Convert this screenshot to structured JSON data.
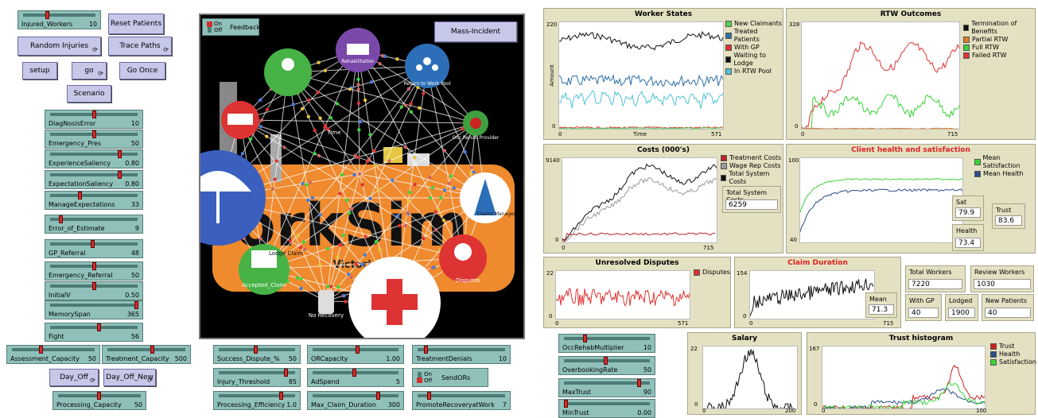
{
  "buttons": {
    "injured_workers": "Injured_Workers",
    "injured_workers_val": "10",
    "reset": "Reset Patients",
    "random": "Random Injuries",
    "trace": "Trace Paths",
    "setup": "setup",
    "go": "go",
    "go_once": "Go Once",
    "scenario": "Scenario",
    "day_off": "Day_Off",
    "day_off_new": "Day_Off_New",
    "mass": "Mass-Incident"
  },
  "sliders": [
    {
      "name": "DiagNosisError",
      "value": "10",
      "level": 0.5
    },
    {
      "name": "Emergency_Pres",
      "value": "50",
      "level": 0.5
    },
    {
      "name": "ExperienceSaliency",
      "value": "0.80",
      "level": 0.8
    },
    {
      "name": "ExpectationSaliency",
      "value": "0.80",
      "level": 0.8
    },
    {
      "name": "ManageExpectations",
      "value": "33",
      "level": 0.33
    },
    {
      "name": "Error_of_Estimate",
      "value": "9",
      "level": 0.1
    },
    {
      "name": "GP_Referral",
      "value": "48",
      "level": 0.48
    },
    {
      "name": "Emergency_Referral",
      "value": "50",
      "level": 0.5
    },
    {
      "name": "InitialV",
      "value": "0.50",
      "level": 0.5
    },
    {
      "name": "MemorySpan",
      "value": "365",
      "level": 1.0
    },
    {
      "name": "Fight",
      "value": "56",
      "level": 0.56
    }
  ],
  "bottom_sliders": {
    "assessment": {
      "name": "Assessment_Capacity",
      "value": "50"
    },
    "treatment": {
      "name": "Treatment_Capacity",
      "value": "500"
    },
    "processing_cap": {
      "name": "Processing_Capacity",
      "value": "50"
    },
    "success": {
      "name": "Success_Dispute_%",
      "value": "50"
    },
    "injury": {
      "name": "Injury_Threshold",
      "value": "85"
    },
    "proc_eff": {
      "name": "Processing_Efficiency",
      "value": "1.0"
    },
    "orcap": {
      "name": "ORCapacity",
      "value": "1.00"
    },
    "adspend": {
      "name": "AdSpend",
      "value": "5"
    },
    "maxclaim": {
      "name": "Max_Claim_Duration",
      "value": "300"
    },
    "denials": {
      "name": "TreatmentDenials",
      "value": "10"
    },
    "promote": {
      "name": "PromoteRecoveryatWork",
      "value": "7"
    },
    "occrehab": {
      "name": "OccRehabMultiplier",
      "value": "10"
    },
    "overbook": {
      "name": "OverbookingRate",
      "value": "50"
    },
    "maxtrust": {
      "name": "MaxTrust",
      "value": "90"
    },
    "mintrust": {
      "name": "MinTrust",
      "value": "0.00"
    }
  },
  "switches": {
    "feedback": "Feedback",
    "sendors": "SendORs",
    "on": "On",
    "off": "Off"
  },
  "world": {
    "banner": "orkSim",
    "subtitle": "Victoria",
    "labels": [
      "Rehabilitation",
      "Return to Work Pool",
      "Occ Rehab Provider",
      "Claims Manager",
      "Disputes",
      "No Recovery",
      "Lodge Claim",
      "Accepted_Claim",
      "Time",
      "Employer"
    ]
  },
  "plots": {
    "worker_states": {
      "title": "Worker States",
      "ymax": "220",
      "ymin": "0",
      "xmin": "0",
      "xmax": "571",
      "xlabel": "Time",
      "ylabel": "Amount",
      "legend": [
        {
          "name": "New Claimants",
          "color": "#55d055"
        },
        {
          "name": "Treated Patients",
          "color": "#2c6fa6"
        },
        {
          "name": "With GP",
          "color": "#d33"
        },
        {
          "name": "Waiting to Lodge",
          "color": "#111"
        },
        {
          "name": "In RTW Pool",
          "color": "#4ec3d6"
        }
      ]
    },
    "rtw": {
      "title": "RTW Outcomes",
      "ymax": "328",
      "ymin": "0",
      "xmin": "0",
      "xmax": "715",
      "legend": [
        {
          "name": "Termination of Benefits",
          "color": "#111"
        },
        {
          "name": "Partial RTW",
          "color": "#e07b22"
        },
        {
          "name": "Full RTW",
          "color": "#3cd33c"
        },
        {
          "name": "Failed RTW",
          "color": "#d33"
        }
      ]
    },
    "costs": {
      "title": "Costs (000's)",
      "ymax": "9140",
      "ymin": "0",
      "xmin": "0",
      "xmax": "715",
      "legend": [
        {
          "name": "Treatment Costs",
          "color": "#b22"
        },
        {
          "name": "Wage Rep Costs",
          "color": "#999"
        },
        {
          "name": "Total System Costs",
          "color": "#111"
        }
      ],
      "monitor_label": "Total System Costs",
      "monitor_value": "6259"
    },
    "health": {
      "title": "Client health and satisfaction",
      "ymax": "100",
      "ymin": "40",
      "legend": [
        {
          "name": "Mean Satisfaction",
          "color": "#3cd33c"
        },
        {
          "name": "Mean Health",
          "color": "#2c4c88"
        }
      ]
    },
    "disputes": {
      "title": "Unresolved Disputes",
      "ymax": "22",
      "ymin": "0",
      "xmin": "0",
      "xmax": "571",
      "legend": [
        {
          "name": "Disputes",
          "color": "#d33"
        }
      ]
    },
    "claim": {
      "title": "Claim Duration",
      "ymax": "154",
      "ymin": "0",
      "xmin": "0",
      "xmax": "715",
      "mean_label": "Mean",
      "mean_value": "71.3"
    },
    "salary": {
      "title": "Salary",
      "ymax": "22",
      "ymin": "0",
      "xmin": "0",
      "xmax": "200"
    },
    "trust": {
      "title": "Trust histogram",
      "ymax": "167",
      "ymin": "0",
      "xmin": "0",
      "xmax": "100",
      "legend": [
        {
          "name": "Trust",
          "color": "#c22"
        },
        {
          "name": "Health",
          "color": "#2c4c88"
        },
        {
          "name": "Satisfaction",
          "color": "#3cd33c"
        }
      ]
    }
  },
  "monitors": {
    "sat": {
      "label": "Sat",
      "value": "79.9"
    },
    "trust": {
      "label": "Trust",
      "value": "83.6"
    },
    "health": {
      "label": "Health",
      "value": "73.4"
    },
    "total_workers": {
      "label": "Total Workers",
      "value": "7220"
    },
    "review_workers": {
      "label": "Review Workers",
      "value": "1030"
    },
    "with_gp": {
      "label": "With GP",
      "value": "40"
    },
    "lodged": {
      "label": "Lodged",
      "value": "1900"
    },
    "new_patients": {
      "label": "New Patients",
      "value": "40"
    }
  }
}
